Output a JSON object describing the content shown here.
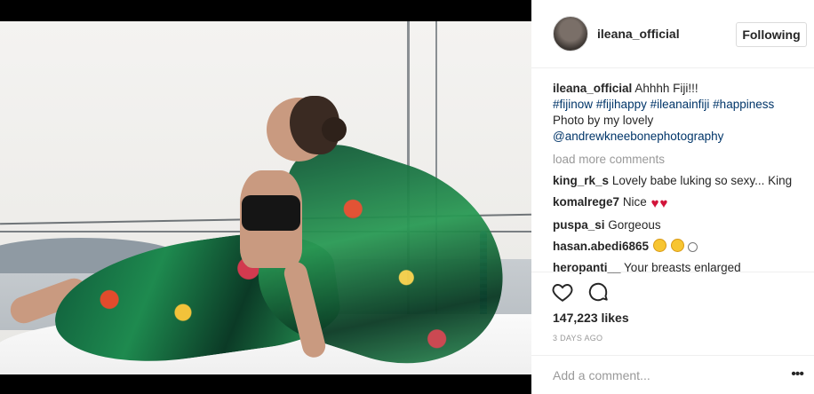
{
  "photo": {
    "description_icon": "photo"
  },
  "header": {
    "username": "ileana_official",
    "follow_label": "Following"
  },
  "caption": {
    "username": "ileana_official",
    "text": "Ahhhh Fiji!!!",
    "hashtags": [
      "#fijinow",
      "#fijihappy",
      "#ileanainfiji",
      "#happiness"
    ],
    "credit": "Photo by my lovely",
    "mention": "@andrewkneebonephotography"
  },
  "load_more": "load more comments",
  "comments": [
    {
      "user": "king_rk_s",
      "text": "Lovely babe luking so sexy... King"
    },
    {
      "user": "komalrege7",
      "text": "Nice"
    },
    {
      "user": "puspa_si",
      "text": "Gorgeous"
    },
    {
      "user": "hasan.abedi6865",
      "text": ""
    },
    {
      "user": "heropanti__",
      "text": "Your breasts enlarged"
    }
  ],
  "actions": {
    "like_icon": "heart-icon",
    "comment_icon": "comment-icon"
  },
  "likes": "147,223 likes",
  "timestamp": "3 DAYS AGO",
  "add_comment": {
    "placeholder": "Add a comment...",
    "more": "•••"
  }
}
